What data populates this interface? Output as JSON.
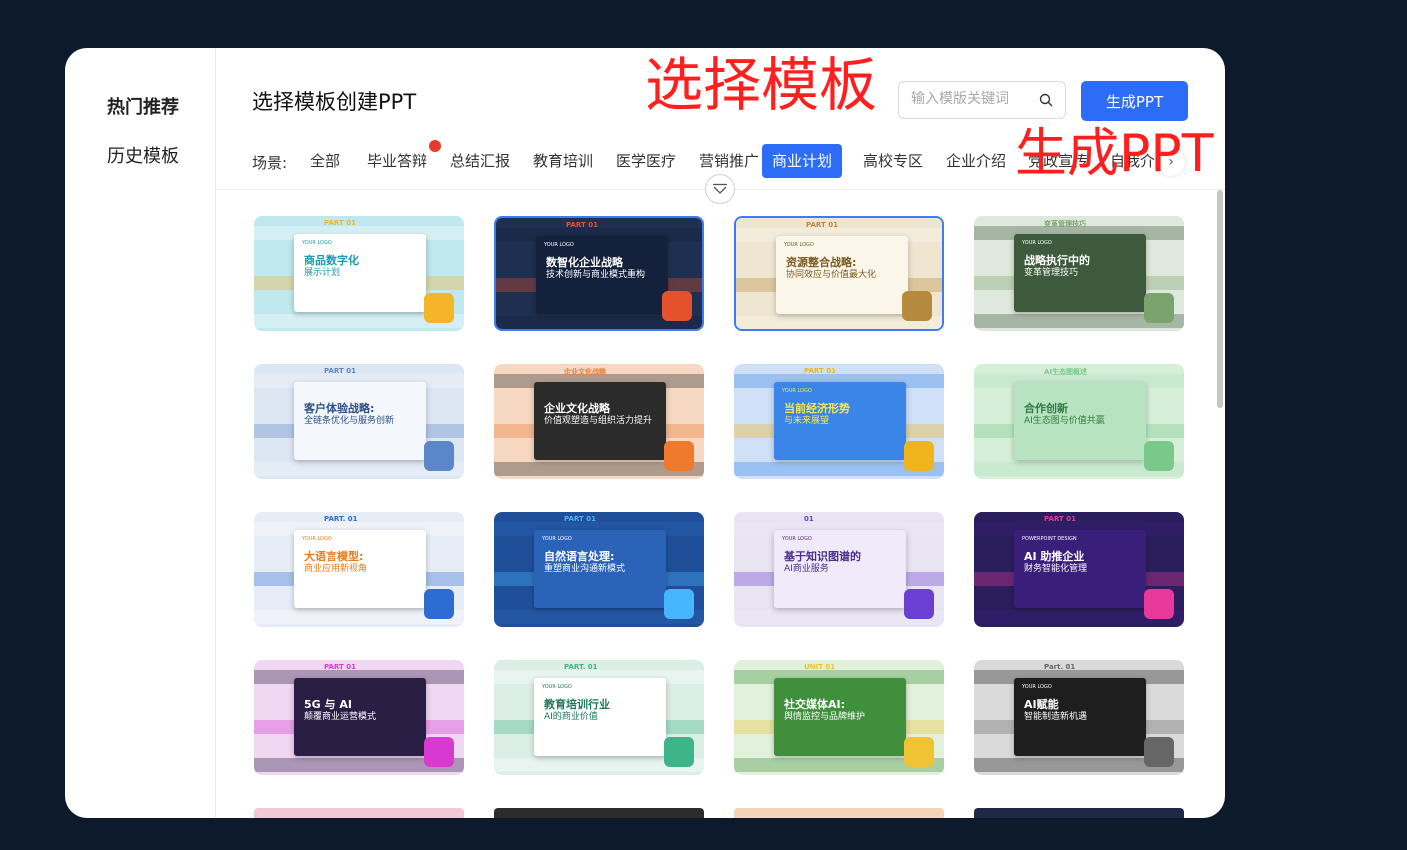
{
  "sidebar": {
    "items": [
      {
        "label": "热门推荐",
        "active": true
      },
      {
        "label": "历史模板",
        "active": false
      }
    ]
  },
  "header": {
    "title": "选择模板创建PPT",
    "search_placeholder": "输入模版关键词",
    "search_value": "",
    "generate_label": "生成PPT"
  },
  "overlays": {
    "select_template": "选择模板",
    "generate_ppt": "生成PPT"
  },
  "filters": {
    "scene_label": "场景:",
    "tabs": [
      {
        "label": "全部"
      },
      {
        "label": "毕业答辩",
        "hot": true
      },
      {
        "label": "总结汇报"
      },
      {
        "label": "教育培训"
      },
      {
        "label": "医学医疗"
      },
      {
        "label": "营销推广"
      },
      {
        "label": "商业计划",
        "active": true
      },
      {
        "label": "高校专区"
      },
      {
        "label": "企业介绍"
      },
      {
        "label": "党政宣传"
      },
      {
        "label": "自我介"
      }
    ]
  },
  "templates": [
    {
      "part": "PART 01",
      "title": "商品数字化",
      "subtitle": "展示计划",
      "logo": "YOUR LOGO",
      "colors": {
        "bg": "#bfe8ef",
        "slide": "#ffffff",
        "text": "#1a9bb0",
        "accent": "#f5b52a"
      }
    },
    {
      "part": "PART 01",
      "title": "数智化企业战略",
      "subtitle": "技术创新与商业模式重构",
      "logo": "YOUR LOGO",
      "colors": {
        "bg": "#1e2f4f",
        "slide": "#13213d",
        "text": "#ffffff",
        "accent": "#e3522a"
      },
      "selected": true
    },
    {
      "part": "PART 01",
      "title": "资源整合战略:",
      "subtitle": "协同效应与价值最大化",
      "logo": "YOUR LOGO",
      "colors": {
        "bg": "#efe6d2",
        "slide": "#fbf6ea",
        "text": "#7a5a1f",
        "accent": "#b68a3c"
      },
      "selected": true
    },
    {
      "part": "变革管理技巧",
      "title": "战略执行中的",
      "subtitle": "变革管理技巧",
      "logo": "YOUR LOGO",
      "colors": {
        "bg": "#dfe8dc",
        "slide": "#3d5a3c",
        "text": "#ffffff",
        "accent": "#7aa36d"
      }
    },
    {
      "part": "PART 01",
      "title": "客户体验战略:",
      "subtitle": "全链条优化与服务创新",
      "logo": "",
      "colors": {
        "bg": "#dde6f3",
        "slide": "#f4f7fb",
        "text": "#2c4f88",
        "accent": "#5b86c7"
      }
    },
    {
      "part": "企业文化战略",
      "title": "企业文化战略",
      "subtitle": "价值观塑造与组织活力提升",
      "logo": "",
      "colors": {
        "bg": "#f6d8c3",
        "slide": "#2b2b2b",
        "text": "#ffffff",
        "accent": "#ef7a2e"
      }
    },
    {
      "part": "PART 01",
      "title": "当前经济形势",
      "subtitle": "与未来展望",
      "logo": "YOUR LOGO",
      "colors": {
        "bg": "#cfe0f7",
        "slide": "#3a86e8",
        "text": "#ffe54a",
        "accent": "#f2b41d"
      }
    },
    {
      "part": "AI生态图概述",
      "title": "合作创新",
      "subtitle": "AI生态图与价值共赢",
      "logo": "",
      "colors": {
        "bg": "#d5efd9",
        "slide": "#b8e3c0",
        "text": "#2f7d3e",
        "accent": "#7ac98a"
      }
    },
    {
      "part": "PART. 01",
      "title": "大语言模型:",
      "subtitle": "商业应用新视角",
      "logo": "YOUR LOGO",
      "colors": {
        "bg": "#e6edf6",
        "slide": "#ffffff",
        "text": "#e87d1e",
        "accent": "#2d6cd2"
      }
    },
    {
      "part": "PART 01",
      "title": "自然语言处理:",
      "subtitle": "重塑商业沟通新模式",
      "logo": "YOUR LOGO",
      "colors": {
        "bg": "#1f4f99",
        "slide": "#2a63b7",
        "text": "#ffffff",
        "accent": "#48b6ff"
      }
    },
    {
      "part": "01",
      "title": "基于知识图谱的",
      "subtitle": "AI商业服务",
      "logo": "YOUR LOGO",
      "colors": {
        "bg": "#e8e4f2",
        "slide": "#f0eafa",
        "text": "#4a2f8a",
        "accent": "#6b3fd1"
      }
    },
    {
      "part": "PART 01",
      "title": "AI 助推企业",
      "subtitle": "财务智能化管理",
      "logo": "POWERPOINT DESIGN",
      "colors": {
        "bg": "#2a1e5c",
        "slide": "#3a1f7a",
        "text": "#ffffff",
        "accent": "#e8389a"
      }
    },
    {
      "part": "PART 01",
      "title": "5G 与 AI",
      "subtitle": "颠覆商业运营模式",
      "logo": "",
      "colors": {
        "bg": "#f0d8f2",
        "slide": "#2b1e45",
        "text": "#ffffff",
        "accent": "#d83ad1"
      }
    },
    {
      "part": "PART. 01",
      "title": "教育培训行业",
      "subtitle": "AI的商业价值",
      "logo": "YOUR LOGO",
      "colors": {
        "bg": "#dcefe6",
        "slide": "#ffffff",
        "text": "#1d7a58",
        "accent": "#3db489"
      }
    },
    {
      "part": "UNIT 01",
      "title": "社交媒体AI:",
      "subtitle": "舆情监控与品牌维护",
      "logo": "",
      "colors": {
        "bg": "#e1f1dc",
        "slide": "#3f8f3d",
        "text": "#ffffff",
        "accent": "#f1c233"
      }
    },
    {
      "part": "Part. 01",
      "title": "AI赋能",
      "subtitle": "智能制造新机遇",
      "logo": "YOUR LOGO",
      "colors": {
        "bg": "#dadada",
        "slide": "#1e1e1e",
        "text": "#ffffff",
        "accent": "#666666"
      }
    }
  ],
  "peek_rows": [
    {
      "color": "#f0c8d8"
    },
    {
      "color": "#2c2c2c"
    },
    {
      "color": "#f4d4b8"
    },
    {
      "color": "#1e2a45"
    }
  ]
}
